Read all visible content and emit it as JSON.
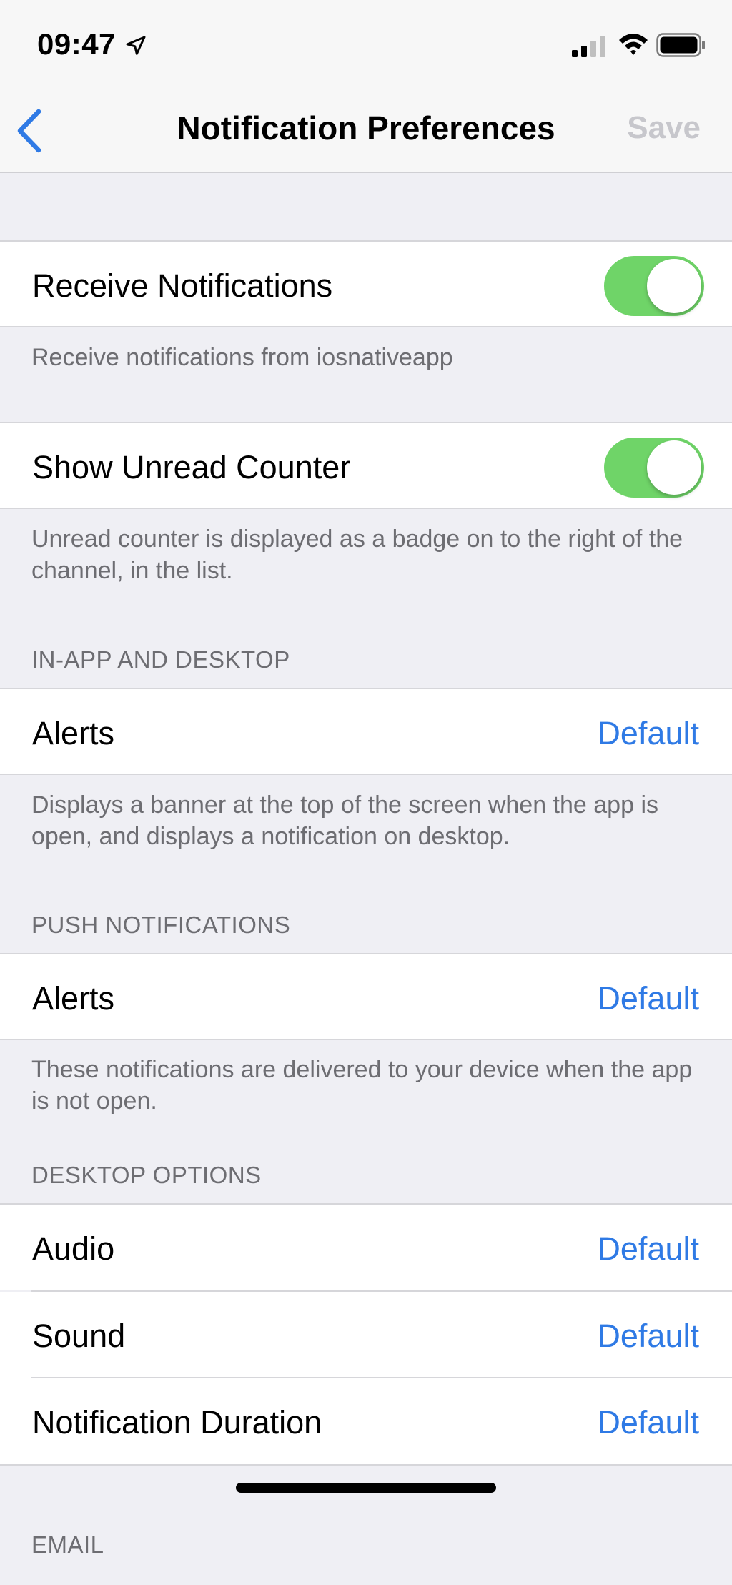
{
  "status_bar": {
    "time": "09:47",
    "location_icon": "location-arrow-icon",
    "signal_icon": "cellular-signal-icon",
    "wifi_icon": "wifi-icon",
    "battery_icon": "battery-icon"
  },
  "nav": {
    "back_icon": "chevron-left-icon",
    "title": "Notification Preferences",
    "save_label": "Save"
  },
  "general": {
    "receive_label": "Receive Notifications",
    "receive_on": true,
    "receive_footer": "Receive notifications from iosnativeapp",
    "unread_label": "Show Unread Counter",
    "unread_on": true,
    "unread_footer": "Unread counter is displayed as a badge on to the right of the channel, in the list."
  },
  "in_app": {
    "header": "IN-APP AND DESKTOP",
    "alerts_label": "Alerts",
    "alerts_value": "Default",
    "footer": "Displays a banner at the top of the screen when the app is open, and displays a notification on desktop."
  },
  "push": {
    "header": "PUSH NOTIFICATIONS",
    "alerts_label": "Alerts",
    "alerts_value": "Default",
    "footer": "These notifications are delivered to your device when the app is not open."
  },
  "desktop": {
    "header": "DESKTOP OPTIONS",
    "items": [
      {
        "label": "Audio",
        "value": "Default"
      },
      {
        "label": "Sound",
        "value": "Default"
      },
      {
        "label": "Notification Duration",
        "value": "Default"
      }
    ]
  },
  "email": {
    "header": "EMAIL"
  },
  "colors": {
    "accent": "#2f7ae5",
    "toggle_on": "#6fd468",
    "background": "#efeff4",
    "disabled": "#c7c7cc"
  }
}
